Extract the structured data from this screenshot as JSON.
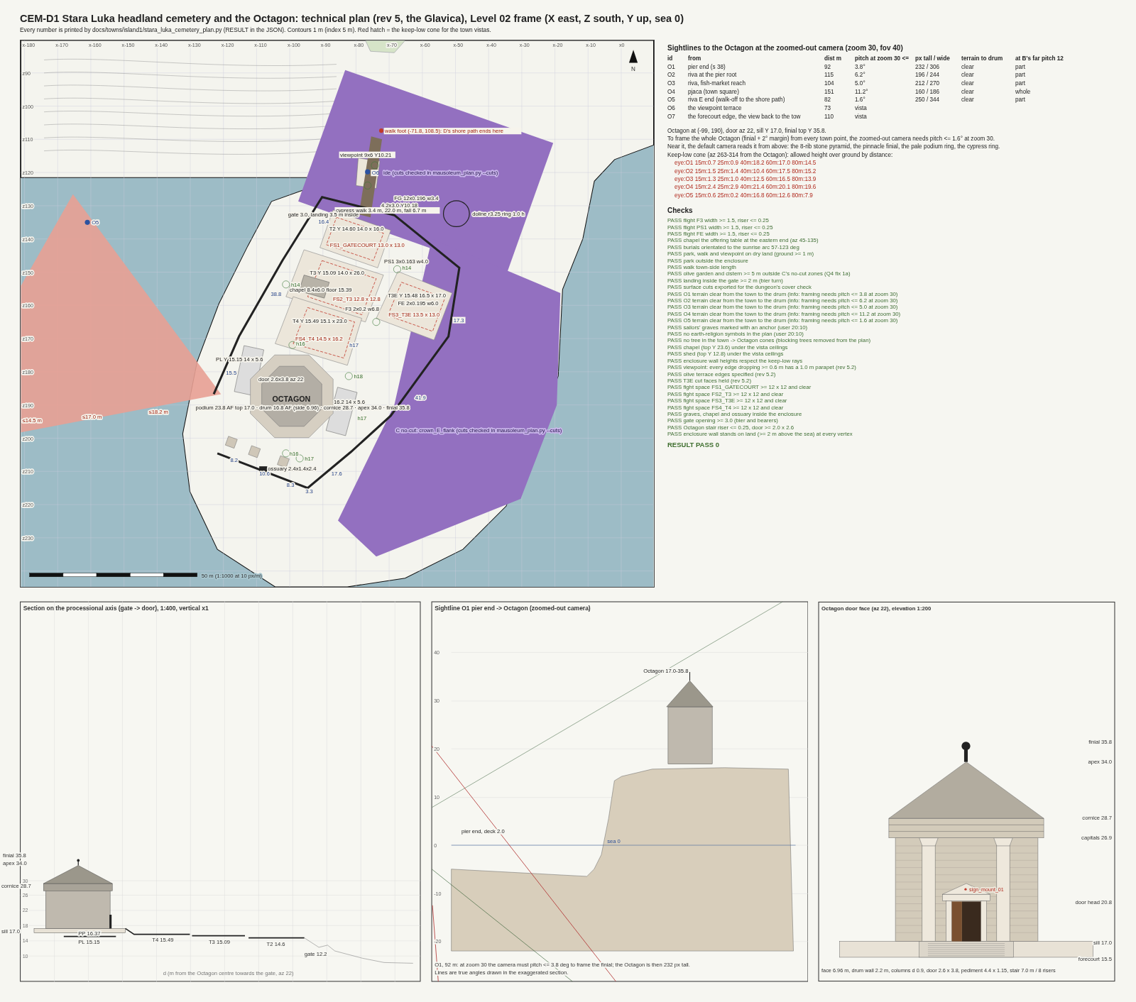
{
  "title": "CEM-D1 Stara Luka headland cemetery and the Octagon: technical plan (rev 5, the Glavica), Level 02 frame (X east, Z south, Y up, sea 0)",
  "subtitle": "Every number is printed by docs/towns/island1/stara_luka_cemetery_plan.py (RESULT in the JSON). Contours 1 m (index 5 m). Red hatch = the keep-low cone for the town vistas.",
  "map": {
    "x_axis": [
      "x-180",
      "x-170",
      "x-160",
      "x-150",
      "x-140",
      "x-130",
      "x-120",
      "x-110",
      "x-100",
      "x-90",
      "x-80",
      "x-70",
      "x-60",
      "x-50",
      "x-40",
      "x-30",
      "x-20",
      "x-10",
      "x0"
    ],
    "z_axis": [
      "z90",
      "z100",
      "z110",
      "z120",
      "z130",
      "z140",
      "z150",
      "z160",
      "z170",
      "z180",
      "z190",
      "z200",
      "z210",
      "z220",
      "z230"
    ],
    "north": "N",
    "scale": "50 m (1:1000 at 10 px/m)",
    "labels": [
      {
        "text": "walk foot (-71.8, 108.5): D's shore path ends here",
        "kind": "red"
      },
      {
        "text": "viewpoint 9x6 Y10.21",
        "kind": "plain"
      },
      {
        "text": "O6",
        "kind": "blue"
      },
      {
        "text": "ide (cuts checked in mausoleum_plan.py --cuts)",
        "kind": "purple"
      },
      {
        "text": "FG 12x0.196 w3.4",
        "kind": "plain"
      },
      {
        "text": "4.2x3.0 Y10.18",
        "kind": "plain"
      },
      {
        "text": "cypress walk 3.4 m, 22.0 m, fall 6.7 m",
        "kind": "plain"
      },
      {
        "text": "gate 3.0, landing 3.5 m inside",
        "kind": "plain"
      },
      {
        "text": "doline r3.25 ring 1.0 h",
        "kind": "plain"
      },
      {
        "text": "O5",
        "kind": "blue"
      },
      {
        "text": "16.4",
        "kind": "blue"
      },
      {
        "text": "T2 Y 14.60  14.0 x 16.0",
        "kind": "plain"
      },
      {
        "text": "FS1_GATECOURT 13.0 x 13.0",
        "kind": "red"
      },
      {
        "text": "PS1 3x0.163 w4.0",
        "kind": "plain"
      },
      {
        "text": "h14",
        "kind": "green"
      },
      {
        "text": "T3 Y 15.09  14.0 x 26.0",
        "kind": "plain"
      },
      {
        "text": "h14",
        "kind": "green"
      },
      {
        "text": "chapel 8.4x6.0 floor 15.39",
        "kind": "plain"
      },
      {
        "text": "38.8",
        "kind": "blue"
      },
      {
        "text": "FS2_T3 12.8 x 12.8",
        "kind": "red"
      },
      {
        "text": "T3E Y 15.48  16.5 x 17.0",
        "kind": "plain"
      },
      {
        "text": "FE 2x0.195 w6.0",
        "kind": "plain"
      },
      {
        "text": "F3 2x0.2 w6.8",
        "kind": "plain"
      },
      {
        "text": "FS3_T3E 13.5 x 13.0",
        "kind": "red"
      },
      {
        "text": "17.3",
        "kind": "blue"
      },
      {
        "text": "T4 Y 15.49  15.1 x 23.0",
        "kind": "plain"
      },
      {
        "text": "FS4_T4 14.5 x 16.2",
        "kind": "red"
      },
      {
        "text": "h16",
        "kind": "green"
      },
      {
        "text": "h17",
        "kind": "blue"
      },
      {
        "text": "PL Y 15.15  14 x 5.6",
        "kind": "plain"
      },
      {
        "text": "15.5",
        "kind": "blue"
      },
      {
        "text": "door 2.6x3.8 az 22",
        "kind": "plain"
      },
      {
        "text": "h18",
        "kind": "green"
      },
      {
        "text": "OCTAGON",
        "kind": "bold"
      },
      {
        "text": "16.2  14 x 5.6",
        "kind": "plain"
      },
      {
        "text": "podium 23.8 AF top 17.0 · drum 16.8 AF (side 6.96) · cornice 28.7 · apex 34.0 · finial 35.8",
        "kind": "plain"
      },
      {
        "text": "41.9",
        "kind": "blue"
      },
      {
        "text": "h17",
        "kind": "green"
      },
      {
        "text": "C no-cut: crown_E_flank (cuts checked in mausoleum_plan.py --cuts)",
        "kind": "purple"
      },
      {
        "text": "≤14.5 m",
        "kind": "red"
      },
      {
        "text": "≤17.0 m",
        "kind": "red"
      },
      {
        "text": "≤18.2 m",
        "kind": "red"
      },
      {
        "text": "h16",
        "kind": "green"
      },
      {
        "text": "h17",
        "kind": "green"
      },
      {
        "text": "8.2",
        "kind": "blue"
      },
      {
        "text": "ossuary 2.4x1.4x2.4",
        "kind": "plain"
      },
      {
        "text": "10.6",
        "kind": "blue"
      },
      {
        "text": "17.6",
        "kind": "blue"
      },
      {
        "text": "8.3",
        "kind": "blue"
      },
      {
        "text": "3.3",
        "kind": "blue"
      }
    ]
  },
  "sightlines": {
    "title": "Sightlines to the Octagon at the zoomed-out camera (zoom 30, fov 40)",
    "columns": [
      "id",
      "from",
      "dist m",
      "pitch at zoom 30 <=",
      "px tall / wide",
      "terrain to drum",
      "at B's far pitch 12"
    ],
    "rows": [
      {
        "id": "O1",
        "from": "pier end (s 38)",
        "dist": "92",
        "pitch": "3.8°",
        "px": "232 / 306",
        "terrain": "clear",
        "far": "part"
      },
      {
        "id": "O2",
        "from": "riva at the pier root",
        "dist": "115",
        "pitch": "6.2°",
        "px": "196 / 244",
        "terrain": "clear",
        "far": "part"
      },
      {
        "id": "O3",
        "from": "riva, fish-market reach",
        "dist": "104",
        "pitch": "5.0°",
        "px": "212 / 270",
        "terrain": "clear",
        "far": "part"
      },
      {
        "id": "O4",
        "from": "pjaca (town square)",
        "dist": "151",
        "pitch": "11.2°",
        "px": "160 / 186",
        "terrain": "clear",
        "far": "whole"
      },
      {
        "id": "O5",
        "from": "riva E end (walk-off to the shore path)",
        "dist": "82",
        "pitch": "1.6°",
        "px": "250 / 344",
        "terrain": "clear",
        "far": "part"
      },
      {
        "id": "O6",
        "from": "the viewpoint terrace",
        "dist": "73",
        "pitch": "vista"
      },
      {
        "id": "O7",
        "from": "the forecourt edge, the view back to the tow",
        "dist": "110",
        "pitch": "vista"
      }
    ],
    "notes": [
      "Octagon at (-99, 190), door az 22, sill Y 17.0, finial top Y 35.8.",
      "To frame the whole Octagon (finial + 2° margin) from every town point, the zoomed-out camera needs pitch <= 1.6° at zoom 30.",
      "Near it, the default camera reads it from above: the 8-rib stone pyramid, the pinnacle finial, the pale podium ring, the cypress ring.",
      "Keep-low cone (az 263-314 from the Octagon): allowed height over ground by distance:"
    ],
    "cone": [
      "eye:O1  15m:0.7  25m:0.9  40m:18.2  60m:17.0  80m:14.5",
      "eye:O2  15m:1.5  25m:1.4  40m:10.4  60m:17.5  80m:15.2",
      "eye:O3  15m:1.3  25m:1.0  40m:12.5  60m:16.5  80m:13.9",
      "eye:O4  15m:2.4  25m:2.9  40m:21.4  60m:20.1  80m:19.6",
      "eye:O5  15m:0.6  25m:0.2  40m:16.8  60m:12.6  80m:7.9"
    ]
  },
  "checks": {
    "title": "Checks",
    "items": [
      "PASS flight F3 width >= 1.5, riser <= 0.25",
      "PASS flight PS1 width >= 1.5, riser <= 0.25",
      "PASS flight FE width >= 1.5, riser <= 0.25",
      "PASS chapel the offering table at the eastern end (az 45-135)",
      "PASS burials orientated to the sunrise arc 57-123 deg",
      "PASS park, walk and viewpoint on dry land (ground >= 1 m)",
      "PASS park outside the enclosure",
      "PASS walk town-side length",
      "PASS olive garden and cistern >= 5 m outside C's no-cut zones (Q4 fix 1a)",
      "PASS landing inside the gate >= 2 m (bier turn)",
      "PASS surface cuts exported for the dungeon's cover check",
      "PASS O1 terrain clear from the town to the drum (info: framing needs pitch <= 3.8 at zoom 30)",
      "PASS O2 terrain clear from the town to the drum (info: framing needs pitch <= 6.2 at zoom 30)",
      "PASS O3 terrain clear from the town to the drum (info: framing needs pitch <= 5.0 at zoom 30)",
      "PASS O4 terrain clear from the town to the drum (info: framing needs pitch <= 11.2 at zoom 30)",
      "PASS O5 terrain clear from the town to the drum (info: framing needs pitch <= 1.6 at zoom 30)",
      "PASS sailors' graves marked with an anchor (user 20:10)",
      "PASS no earth-religion symbols in the plan (user 20:10)",
      "PASS no tree in the town -> Octagon cones (blocking trees removed from the plan)",
      "PASS chapel (top Y 23.6) under the vista ceilings",
      "PASS shed (top Y 12.8) under the vista ceilings",
      "PASS enclosure wall heights respect the keep-low rays",
      "PASS viewpoint: every edge dropping >= 0.6 m has a 1.0 m parapet (rev 5.2)",
      "PASS olive terrace edges specified (rev 5.2)",
      "PASS T3E cut faces held (rev 5.2)",
      "PASS fight space FS1_GATECOURT >= 12 x 12 and clear",
      "PASS fight space FS2_T3 >= 12 x 12 and clear",
      "PASS fight space FS3_T3E >= 12 x 12 and clear",
      "PASS fight space FS4_T4 >= 12 x 12 and clear",
      "PASS graves, chapel and ossuary inside the enclosure",
      "PASS gate opening >= 3.0 (bier and bearers)",
      "PASS Octagon stair riser <= 0.25, door >= 2.0 x 2.6",
      "PASS enclosure wall stands on land (>= 2 m above the sea) at every vertex"
    ],
    "result": "RESULT PASS 0"
  },
  "section": {
    "title": "Section on the processional axis (gate -> door), 1:400, vertical x1",
    "ticks": [
      "30",
      "26",
      "22",
      "18",
      "14",
      "10"
    ],
    "labels": [
      "finial 35.8",
      "apex 34.0",
      "cornice 28.7",
      "sill 17.0",
      "PP 16.37",
      "PL 15.15",
      "T4 15.49",
      "T3 15.09",
      "T2 14.6",
      "gate 12.2"
    ],
    "xlabel": "d (m from the Octagon centre towards the gate, az 22)"
  },
  "sightline": {
    "title": "Sightline O1 pier end -> Octagon (zoomed-out camera)",
    "ticks": [
      "40",
      "30",
      "20",
      "10",
      "0",
      "-10",
      "-20"
    ],
    "labels": [
      "Octagon 17.0-35.8",
      "pier end, deck 2.0",
      "sea 0"
    ],
    "caption": [
      "O1, 92 m: at zoom 30 the camera must pitch <= 3.8 deg to frame the finial; the Octagon is then 232 px tall.",
      "Lines are true angles drawn in the exaggerated section."
    ]
  },
  "elevation": {
    "title": "Octagon door face (az 22), elevation 1:200",
    "labels": [
      "finial 35.8",
      "apex 34.0",
      "cornice 28.7",
      "capitals 26.9",
      "door head 20.8",
      "sill 17.0",
      "forecourt 15.5"
    ],
    "sign": "sign_mount_01",
    "caption": "face 6.96 m, drum wall 2.2 m, columns d 0.9, door 2.6 x 3.8, pediment 4.4 x 1.15, stair 7.0 m / 8 risers"
  }
}
